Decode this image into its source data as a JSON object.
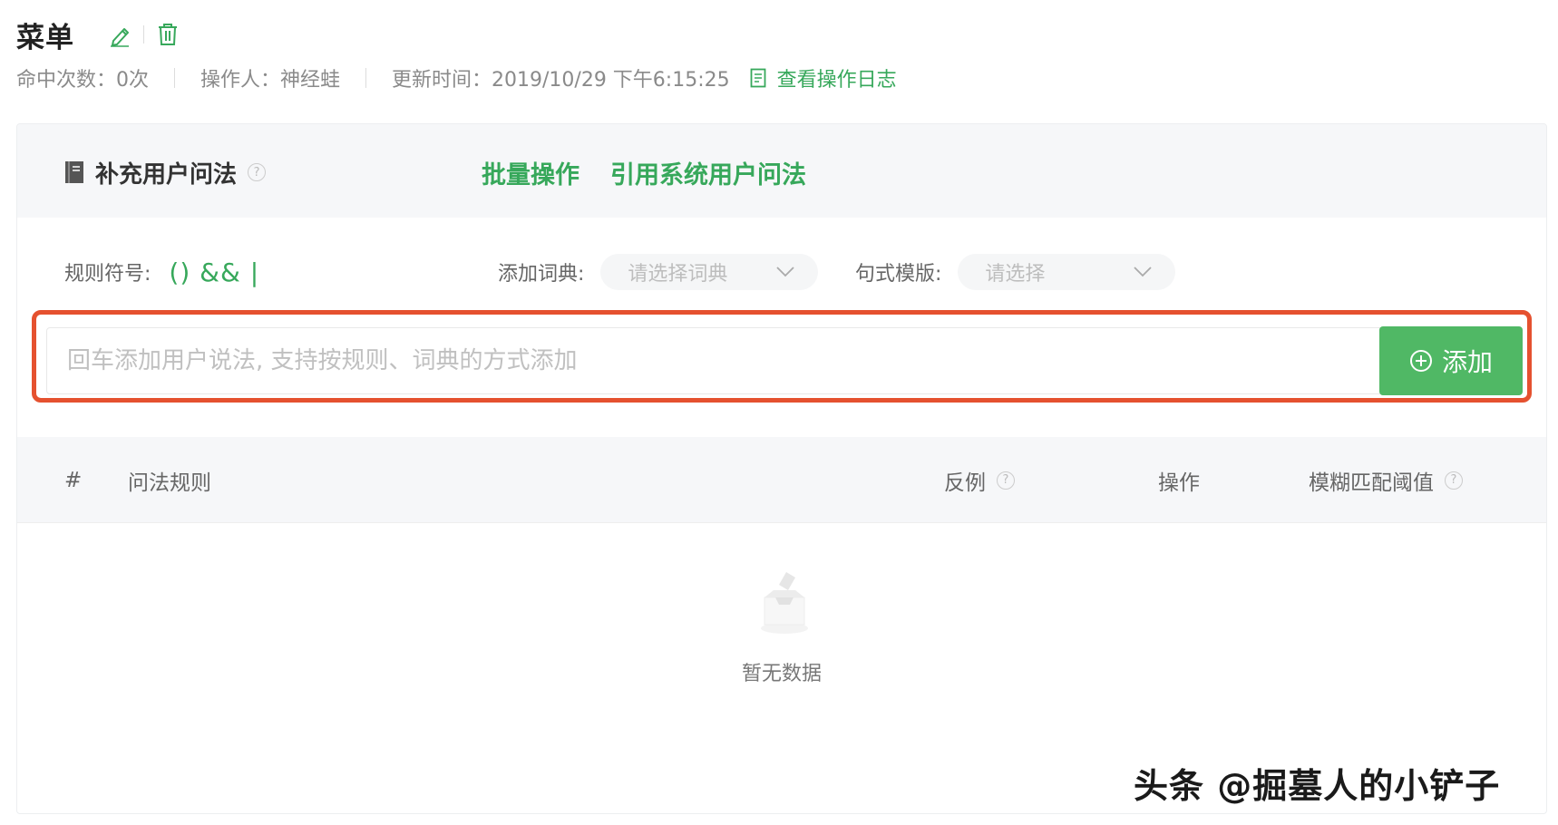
{
  "header": {
    "title": "菜单",
    "icons": {
      "edit": "pencil-icon",
      "delete": "trash-icon"
    },
    "meta": {
      "hits": "命中次数：0次",
      "operator": "操作人：神经蛙",
      "updated": "更新时间：2019/10/29 下午6:15:25",
      "log_link": "查看操作日志"
    }
  },
  "card": {
    "title": "补充用户问法",
    "help": "?",
    "actions": [
      "批量操作",
      "引用系统用户问法"
    ],
    "rule_label": "规则符号:",
    "rule_symbols": "() && |",
    "dict_label": "添加词典:",
    "dict_placeholder": "请选择词典",
    "template_label": "句式模版:",
    "template_placeholder": "请选择",
    "input_placeholder": "回车添加用户说法, 支持按规则、词典的方式添加",
    "input_value": "",
    "add_button": "添加"
  },
  "table": {
    "columns": [
      "#",
      "问法规则",
      "反例",
      "操作",
      "模糊匹配阈值"
    ],
    "help": "?",
    "empty_text": "暂无数据"
  },
  "watermark": "头条 @掘墓人的小铲子",
  "colors": {
    "accent": "#37a85b",
    "button": "#50b865",
    "highlight": "#e5512f"
  }
}
